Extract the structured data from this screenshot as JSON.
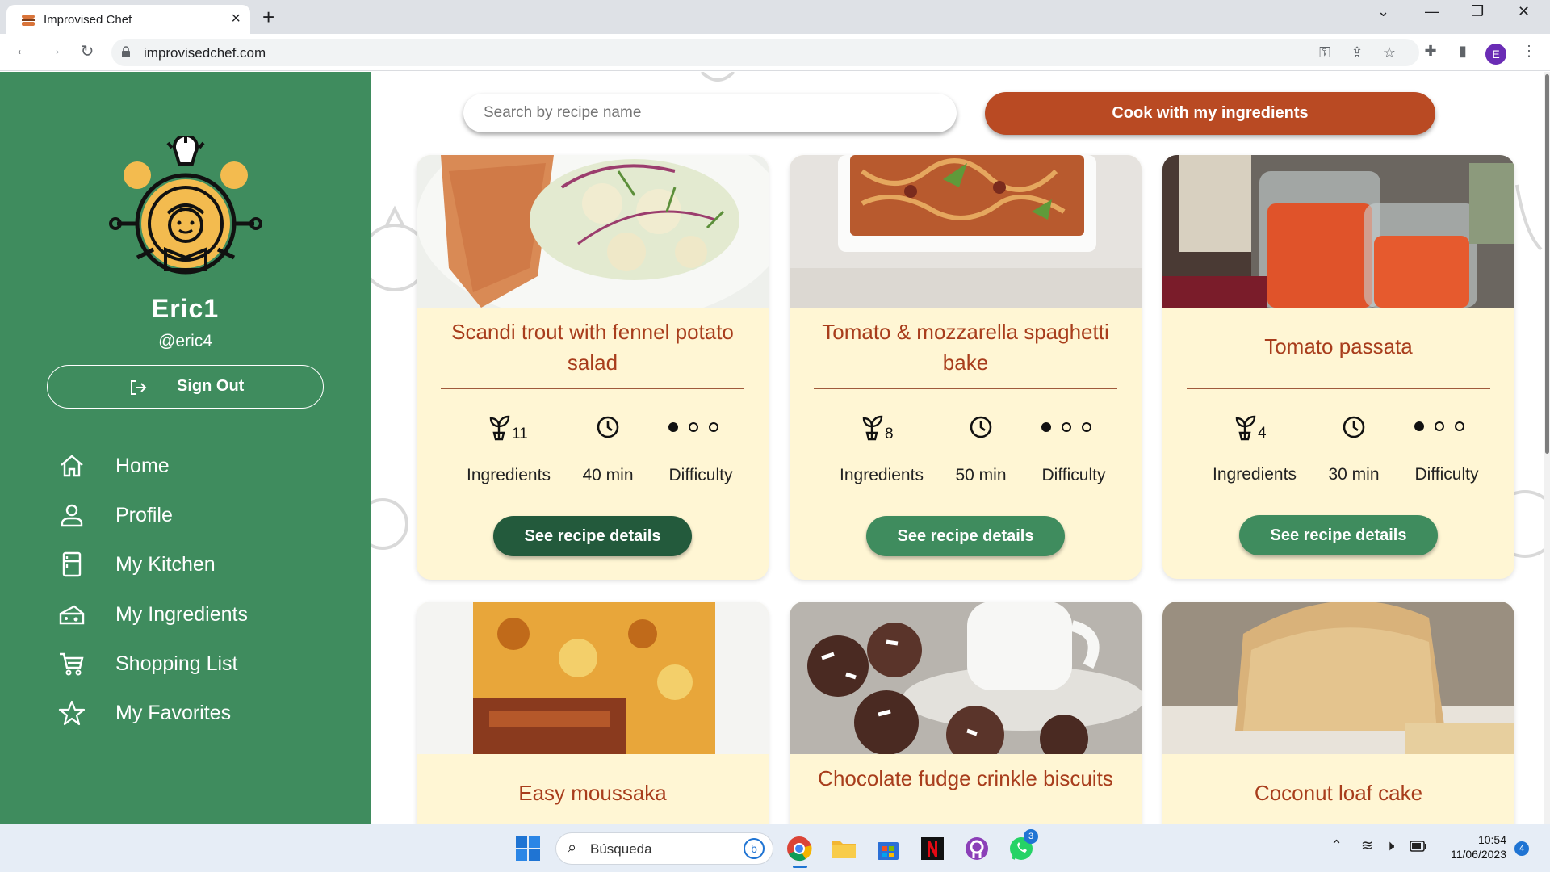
{
  "browser": {
    "tab_title": "Improvised Chef",
    "url": "improvisedchef.com",
    "profile_initial": "E"
  },
  "sidebar": {
    "user_name": "Eric1",
    "user_handle": "@eric4",
    "sign_out": "Sign Out",
    "nav": [
      {
        "label": "Home",
        "icon": "home-icon"
      },
      {
        "label": "Profile",
        "icon": "user-icon"
      },
      {
        "label": "My Kitchen",
        "icon": "fridge-icon"
      },
      {
        "label": "My Ingredients",
        "icon": "cheese-icon"
      },
      {
        "label": "Shopping List",
        "icon": "cart-icon"
      },
      {
        "label": "My Favorites",
        "icon": "star-icon"
      }
    ]
  },
  "main": {
    "search_placeholder": "Search by recipe name",
    "cook_button": "Cook with my ingredients",
    "recipes": [
      {
        "title": "Scandi trout with fennel potato salad",
        "ingredients": "11",
        "ingredients_label": "Ingredients",
        "time": "40 min",
        "difficulty_label": "Difficulty",
        "difficulty_level": 1,
        "button": "See recipe details"
      },
      {
        "title": "Tomato & mozzarella spaghetti bake",
        "ingredients": "8",
        "ingredients_label": "Ingredients",
        "time": "50 min",
        "difficulty_label": "Difficulty",
        "difficulty_level": 1,
        "button": "See recipe details"
      },
      {
        "title": "Tomato passata",
        "ingredients": "4",
        "ingredients_label": "Ingredients",
        "time": "30 min",
        "difficulty_label": "Difficulty",
        "difficulty_level": 1,
        "button": "See recipe details"
      },
      {
        "title": "Easy moussaka"
      },
      {
        "title": "Chocolate fudge crinkle biscuits"
      },
      {
        "title": "Coconut loaf cake"
      }
    ]
  },
  "taskbar": {
    "search_label": "Búsqueda",
    "time": "10:54",
    "date": "11/06/2023",
    "whatsapp_badge": "3",
    "notification_count": "4"
  },
  "colors": {
    "sidebar_green": "#3f8c5e",
    "accent_orange": "#b94a23",
    "card_cream": "#fff6d4",
    "title_rust": "#a83d1c",
    "button_green": "#3f8c5e",
    "button_green_dark": "#235a3c"
  }
}
